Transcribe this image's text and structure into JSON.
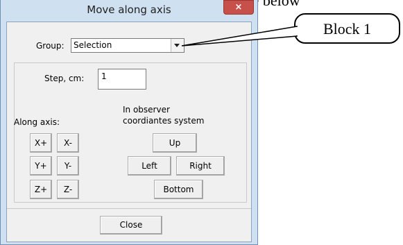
{
  "document": {
    "top_text": ", a window will appear as shown in Figure below"
  },
  "dialog": {
    "title": "Move along axis",
    "close_glyph": "×",
    "group_label": "Group:",
    "group_value": "Selection",
    "step_label": "Step, cm:",
    "step_value": "1",
    "along_axis_label": "Along axis:",
    "observer_label_line1": "In observer",
    "observer_label_line2": "coordiantes system",
    "axis_buttons": [
      "X+",
      "X-",
      "Y+",
      "Y-",
      "Z+",
      "Z-"
    ],
    "up_button": "Up",
    "left_button": "Left",
    "right_button": "Right",
    "bottom_button": "Bottom",
    "close_button": "Close"
  },
  "callout": {
    "text": "Block 1"
  }
}
